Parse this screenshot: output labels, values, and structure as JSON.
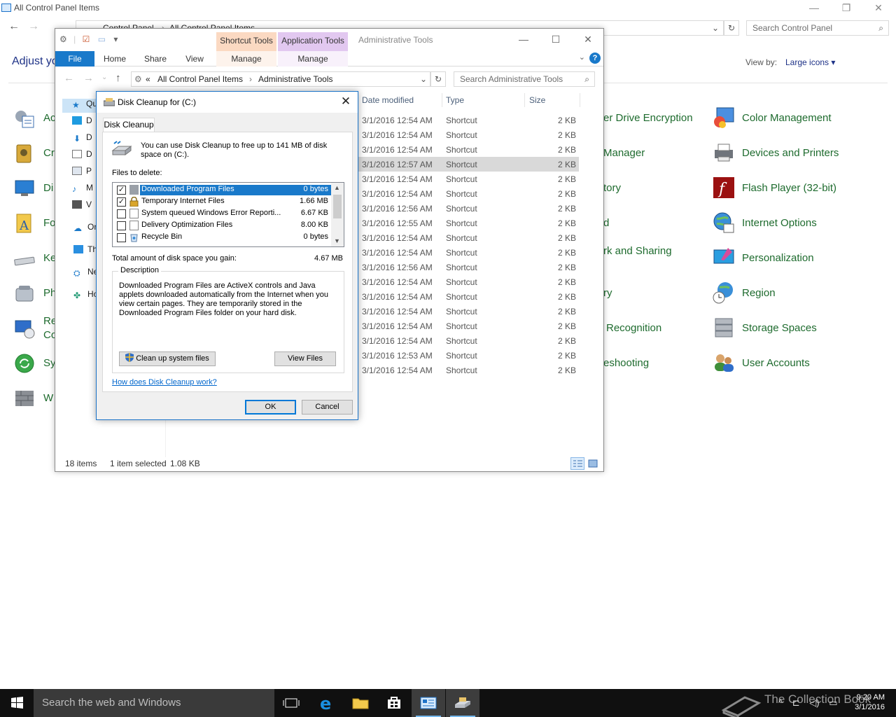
{
  "control_panel": {
    "window_title": "All Control Panel Items",
    "breadcrumb": [
      "Control Panel",
      "All Control Panel Items"
    ],
    "search_placeholder": "Search Control Panel",
    "heading_partial": "Adjust yo",
    "view_by_label": "View by:",
    "view_by_value": "Large icons",
    "left_items_partial": [
      "Ac",
      "Cr",
      "Di",
      "Fo",
      "Ke",
      "Ph",
      "Re",
      "Co",
      "Sy",
      "W"
    ],
    "mid_items_partial": [
      "er Drive Encryption",
      "Manager",
      "tory",
      "d",
      "rk and Sharing",
      "ry",
      "Recognition",
      "eshooting"
    ],
    "right_items": [
      "Color Management",
      "Devices and Printers",
      "Flash Player (32-bit)",
      "Internet Options",
      "Personalization",
      "Region",
      "Storage Spaces",
      "User Accounts"
    ]
  },
  "admin_tools": {
    "window_title": "Administrative Tools",
    "ctx_tab_shortcut": "Shortcut Tools",
    "ctx_tab_application": "Application Tools",
    "ribbon_tabs": [
      "File",
      "Home",
      "Share",
      "View"
    ],
    "ribbon_manage_1": "Manage",
    "ribbon_manage_2": "Manage",
    "breadcrumb": [
      "«",
      "All Control Panel Items",
      "Administrative Tools"
    ],
    "search_placeholder": "Search Administrative Tools",
    "nav_items": [
      "Qu",
      "D",
      "D",
      "D",
      "P",
      "M",
      "V",
      "On",
      "Th",
      "Ne",
      "Ho"
    ],
    "columns": [
      "Date modified",
      "Type",
      "Size"
    ],
    "rows": [
      {
        "date": "3/1/2016 12:54 AM",
        "type": "Shortcut",
        "size": "2 KB"
      },
      {
        "date": "3/1/2016 12:54 AM",
        "type": "Shortcut",
        "size": "2 KB"
      },
      {
        "date": "3/1/2016 12:54 AM",
        "type": "Shortcut",
        "size": "2 KB"
      },
      {
        "date": "3/1/2016 12:57 AM",
        "type": "Shortcut",
        "size": "2 KB"
      },
      {
        "date": "3/1/2016 12:54 AM",
        "type": "Shortcut",
        "size": "2 KB"
      },
      {
        "date": "3/1/2016 12:54 AM",
        "type": "Shortcut",
        "size": "2 KB"
      },
      {
        "date": "3/1/2016 12:56 AM",
        "type": "Shortcut",
        "size": "2 KB"
      },
      {
        "date": "3/1/2016 12:55 AM",
        "type": "Shortcut",
        "size": "2 KB"
      },
      {
        "date": "3/1/2016 12:54 AM",
        "type": "Shortcut",
        "size": "2 KB"
      },
      {
        "date": "3/1/2016 12:54 AM",
        "type": "Shortcut",
        "size": "2 KB"
      },
      {
        "date": "3/1/2016 12:56 AM",
        "type": "Shortcut",
        "size": "2 KB"
      },
      {
        "date": "3/1/2016 12:54 AM",
        "type": "Shortcut",
        "size": "2 KB"
      },
      {
        "date": "3/1/2016 12:54 AM",
        "type": "Shortcut",
        "size": "2 KB"
      },
      {
        "date": "3/1/2016 12:54 AM",
        "type": "Shortcut",
        "size": "2 KB"
      },
      {
        "date": "3/1/2016 12:54 AM",
        "type": "Shortcut",
        "size": "2 KB"
      },
      {
        "date": "3/1/2016 12:54 AM",
        "type": "Shortcut",
        "size": "2 KB"
      },
      {
        "date": "3/1/2016 12:53 AM",
        "type": "Shortcut",
        "size": "2 KB"
      },
      {
        "date": "3/1/2016 12:54 AM",
        "type": "Shortcut",
        "size": "2 KB"
      }
    ],
    "status_count": "18 items",
    "status_selected": "1 item selected",
    "status_size": "1.08 KB"
  },
  "disk_cleanup": {
    "title": "Disk Cleanup for  (C:)",
    "tab": "Disk Cleanup",
    "intro": "You can use Disk Cleanup to free up to 141 MB of disk space on  (C:).",
    "files_label": "Files to delete:",
    "files": [
      {
        "name": "Downloaded Program Files",
        "size": "0 bytes",
        "checked": true
      },
      {
        "name": "Temporary Internet Files",
        "size": "1.66 MB",
        "checked": true
      },
      {
        "name": "System queued Windows Error Reporti...",
        "size": "6.67 KB",
        "checked": false
      },
      {
        "name": "Delivery Optimization Files",
        "size": "8.00 KB",
        "checked": false
      },
      {
        "name": "Recycle Bin",
        "size": "0 bytes",
        "checked": false
      }
    ],
    "total_label": "Total amount of disk space you gain:",
    "total_value": "4.67 MB",
    "description_label": "Description",
    "description": "Downloaded Program Files are ActiveX controls and Java applets downloaded automatically from the Internet when you view certain pages. They are temporarily stored in the Downloaded Program Files folder on your hard disk.",
    "cleanup_system_label": "Clean up system files",
    "view_files_label": "View Files",
    "help_link": "How does Disk Cleanup work?",
    "ok_label": "OK",
    "cancel_label": "Cancel"
  },
  "taskbar": {
    "search_placeholder": "Search the web and Windows",
    "watermark": "The Collection Book",
    "time": "9:20 AM",
    "date": "3/1/2016"
  },
  "colors": {
    "accent": "#1979ca",
    "cp_link_green": "#1e6b2e",
    "selection": "#d9d9d9",
    "ctx_shortcut": "#fbd9c2",
    "ctx_application": "#e2c8f0"
  }
}
